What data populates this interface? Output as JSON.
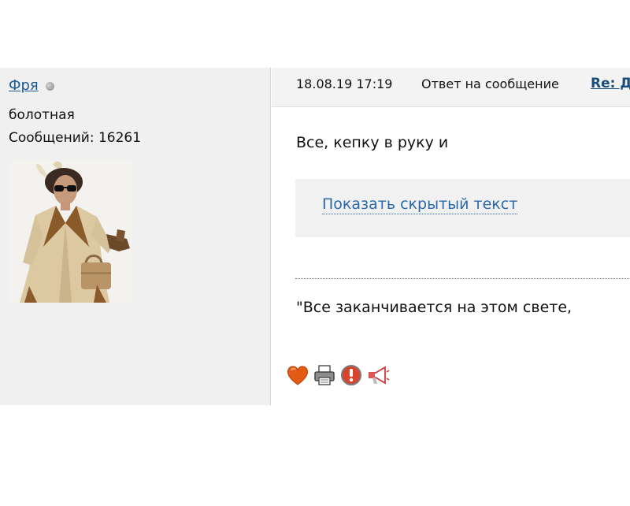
{
  "author": {
    "name": "Фря",
    "rank": "болотная",
    "posts": "Сообщений: 16261"
  },
  "header": {
    "date": "18.08.19 17:19",
    "reply_label": "Ответ на сообщение",
    "reply_link": "Re: Д"
  },
  "body": {
    "text": "Все, кепку в руку и",
    "spoiler_label": "Показать скрытый текст"
  },
  "signature": {
    "text": "\"Все заканчивается на этом свете,"
  },
  "actions": [
    {
      "icon": "heart-icon"
    },
    {
      "icon": "printer-icon"
    },
    {
      "icon": "report-icon"
    },
    {
      "icon": "megaphone-icon"
    }
  ],
  "colors": {
    "link": "#1a5a96",
    "spoiler_link": "#2a68a8",
    "sidebar_bg": "#f0f0f0"
  }
}
